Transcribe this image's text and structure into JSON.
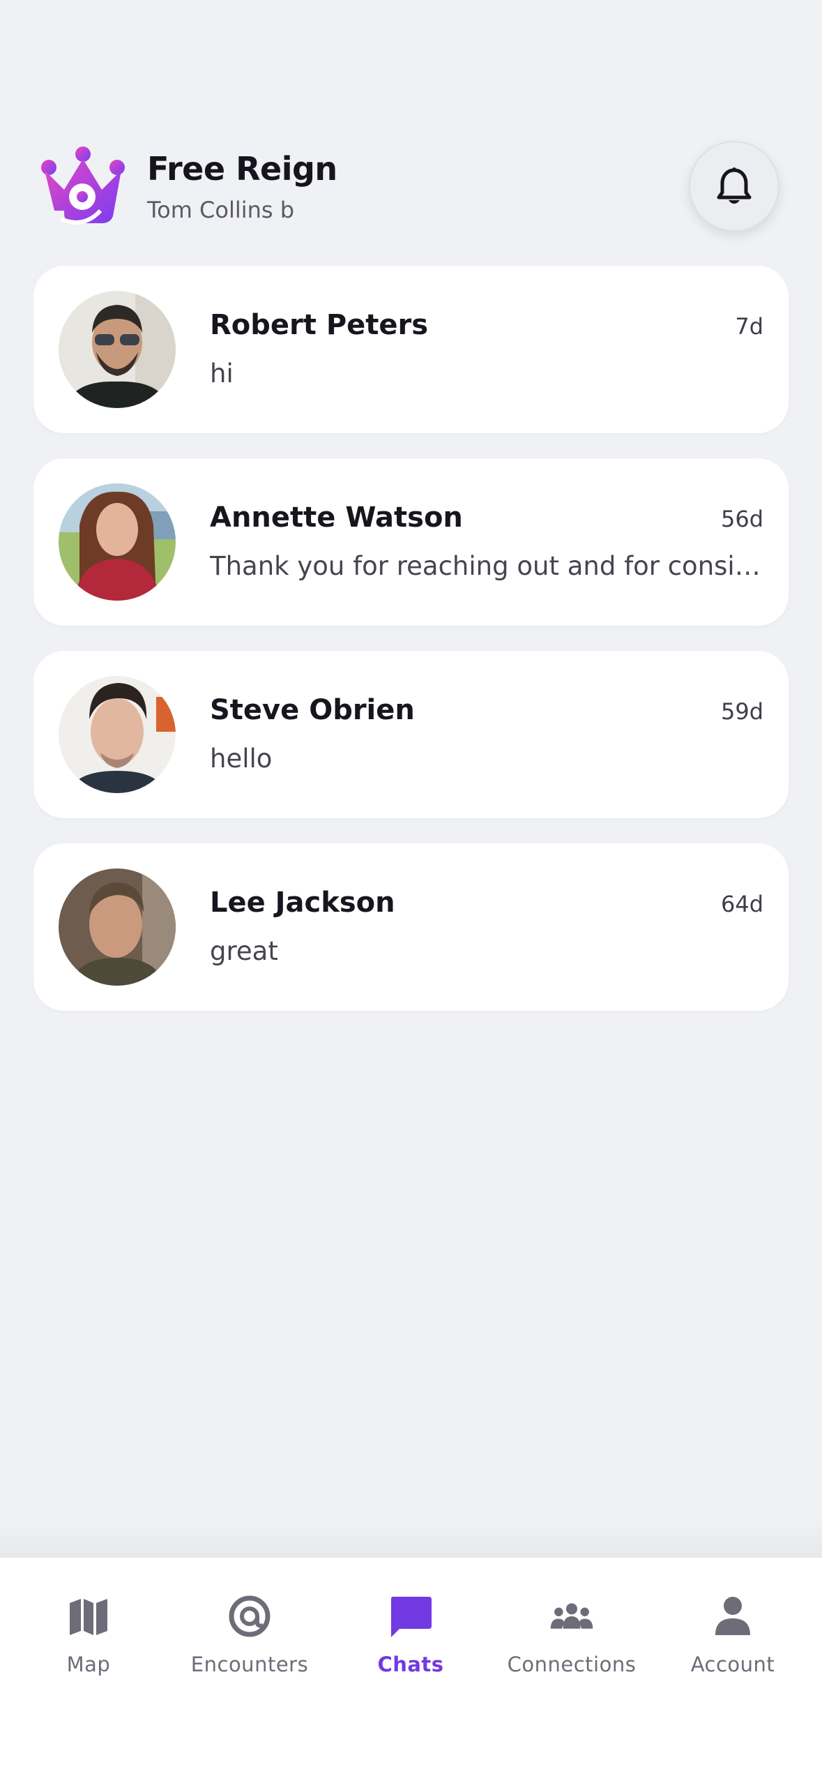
{
  "header": {
    "title": "Free Reign",
    "subtitle": "Tom Collins b",
    "logo_icon": "crown-logo-icon",
    "notification_icon": "bell-icon"
  },
  "chats": [
    {
      "name": "Robert Peters",
      "time": "7d",
      "preview": "hi"
    },
    {
      "name": "Annette Watson",
      "time": "56d",
      "preview": "Thank you for reaching out and for considering me for this opportunity."
    },
    {
      "name": "Steve Obrien",
      "time": "59d",
      "preview": "hello"
    },
    {
      "name": "Lee Jackson",
      "time": "64d",
      "preview": "great"
    }
  ],
  "nav": {
    "items": [
      {
        "label": "Map",
        "icon": "map-icon"
      },
      {
        "label": "Encounters",
        "icon": "radar-icon"
      },
      {
        "label": "Chats",
        "icon": "chat-bubble-icon"
      },
      {
        "label": "Connections",
        "icon": "people-icon"
      },
      {
        "label": "Account",
        "icon": "person-icon"
      }
    ],
    "active": "Chats"
  },
  "colors": {
    "accent": "#7339e3",
    "background": "#f0f1f5",
    "logo_gradient_start": "#e447c4",
    "logo_gradient_end": "#7a3df0"
  }
}
